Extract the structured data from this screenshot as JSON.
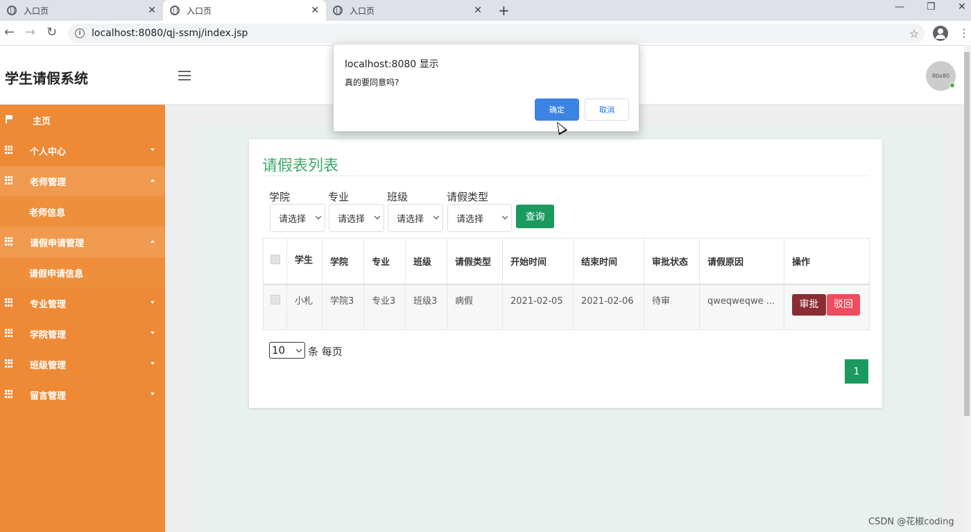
{
  "browser": {
    "tabs": [
      {
        "title": "入口页"
      },
      {
        "title": "入口页"
      },
      {
        "title": "入口页"
      }
    ],
    "url": "localhost:8080/qj-ssmj/index.jsp"
  },
  "header": {
    "brand": "学生请假系统",
    "avatar_text": "80x80"
  },
  "sidebar": {
    "items": [
      {
        "label": "主页"
      },
      {
        "label": "个人中心"
      },
      {
        "label": "老师管理"
      },
      {
        "label": "老师信息"
      },
      {
        "label": "请假申请管理"
      },
      {
        "label": "请假申请信息"
      },
      {
        "label": "专业管理"
      },
      {
        "label": "学院管理"
      },
      {
        "label": "班级管理"
      },
      {
        "label": "留言管理"
      }
    ]
  },
  "main": {
    "title": "请假表列表",
    "filters": [
      {
        "label": "学院",
        "value": "请选择"
      },
      {
        "label": "专业",
        "value": "请选择"
      },
      {
        "label": "班级",
        "value": "请选择"
      },
      {
        "label": "请假类型",
        "value": "请选择"
      }
    ],
    "query_label": "查询",
    "table": {
      "headers": [
        "学生",
        "学院",
        "专业",
        "班级",
        "请假类型",
        "开始时间",
        "结束时间",
        "审批状态",
        "请假原因",
        "操作"
      ],
      "rows": [
        {
          "student": "小札",
          "college": "学院3",
          "major": "专业3",
          "class": "班级3",
          "leave_type": "病假",
          "start": "2021-02-05",
          "end": "2021-02-06",
          "status": "待审",
          "reason": "qweqweqwe ..."
        }
      ],
      "approve_label": "审批",
      "reject_label": "驳回"
    },
    "page_size": "10",
    "page_size_text": "条 每页",
    "current_page": "1"
  },
  "dialog": {
    "title": "localhost:8080 显示",
    "message": "真的要同意吗?",
    "ok_label": "确定",
    "cancel_label": "取消"
  },
  "watermark": "CSDN @花椒coding"
}
